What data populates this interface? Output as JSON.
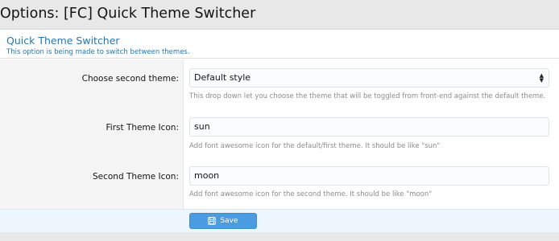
{
  "page": {
    "title": "Options: [FC] Quick Theme Switcher"
  },
  "panel": {
    "title": "Quick Theme Switcher",
    "description": "This option is being made to switch between themes."
  },
  "rows": [
    {
      "label": "Choose second theme:",
      "value": "Default style",
      "hint": "This drop down let you choose the theme that will be toggled from front-end against the default theme."
    },
    {
      "label": "First Theme Icon:",
      "value": "sun",
      "hint": "Add font awesome icon for the default/first theme. It should be like \"sun\""
    },
    {
      "label": "Second Theme Icon:",
      "value": "moon",
      "hint": "Add font awesome icon for the second theme. It should be like \"moon\""
    }
  ],
  "footer": {
    "save_label": "Save",
    "save_icon": "floppy-disk-icon"
  },
  "colors": {
    "accent": "#2577b1",
    "button": "#4b9be0",
    "footer_bg": "#edf6fd"
  }
}
